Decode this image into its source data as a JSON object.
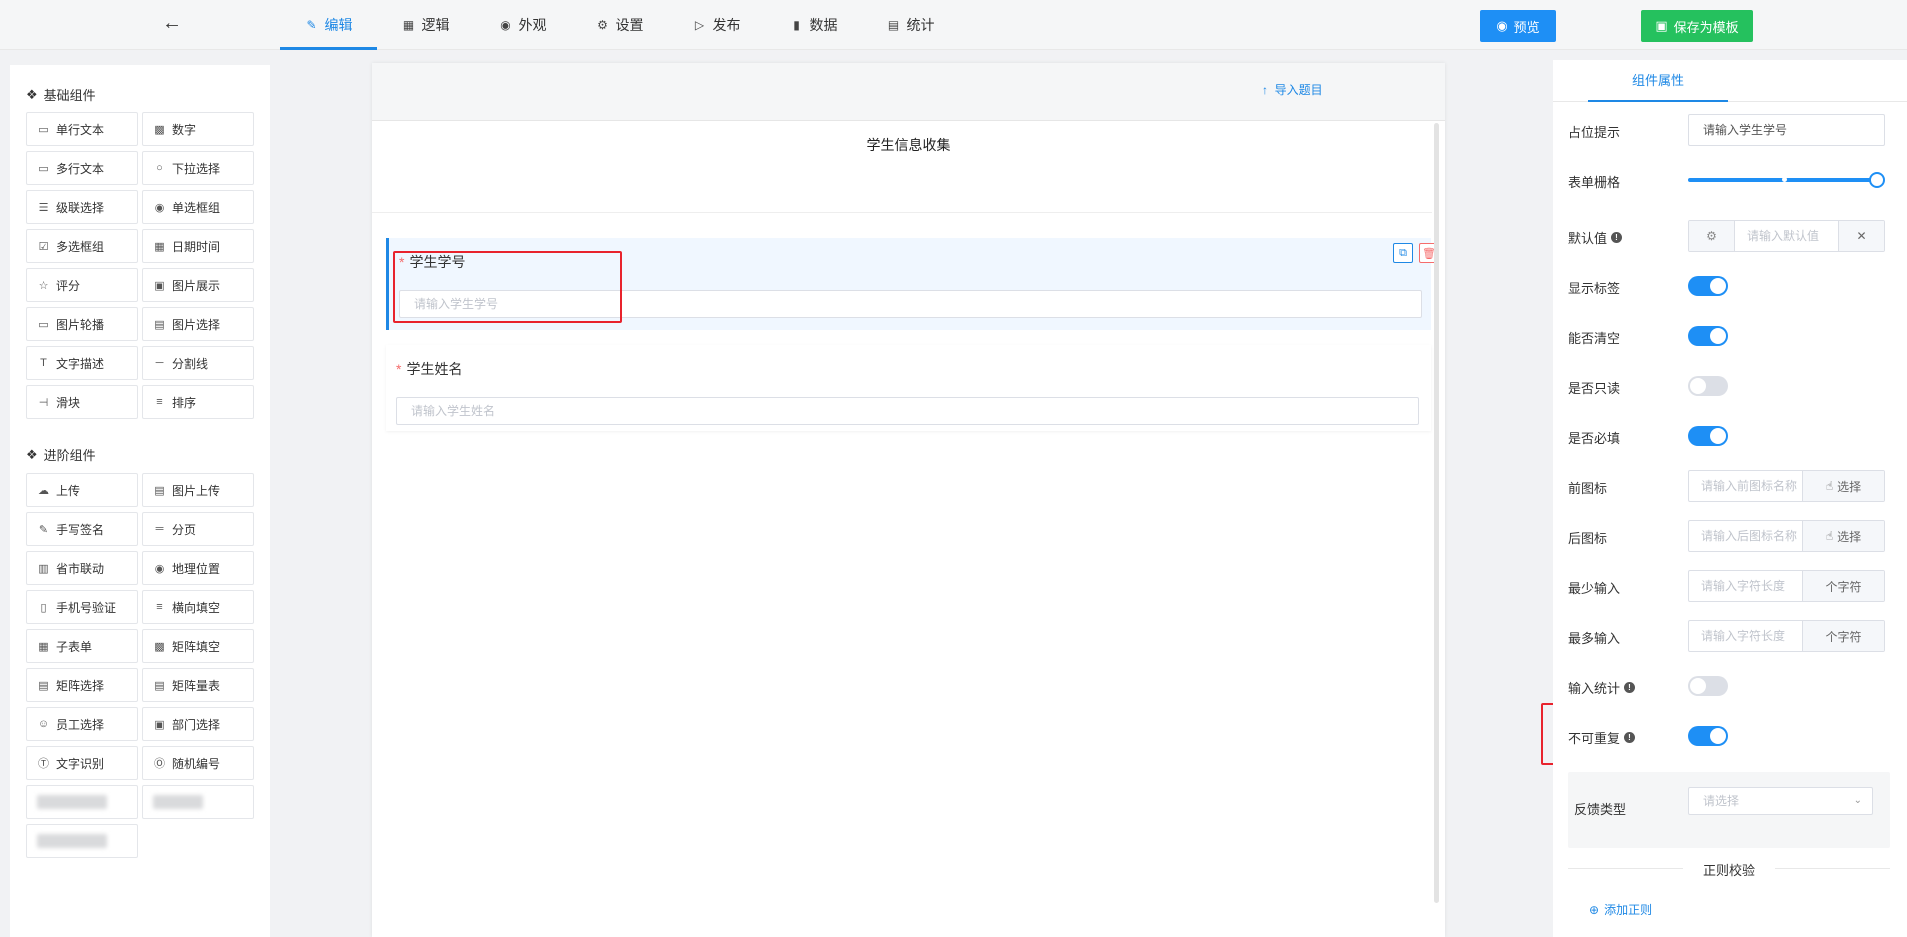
{
  "topbar": {
    "back_icon": "arrow-left-icon",
    "tabs": [
      {
        "label": "编辑",
        "icon": "pencil-icon"
      },
      {
        "label": "逻辑",
        "icon": "grid-icon"
      },
      {
        "label": "外观",
        "icon": "eye-icon"
      },
      {
        "label": "设置",
        "icon": "gear-icon"
      },
      {
        "label": "发布",
        "icon": "play-icon"
      },
      {
        "label": "数据",
        "icon": "bar-chart-icon"
      },
      {
        "label": "统计",
        "icon": "presentation-icon"
      }
    ],
    "active_tab": "编辑",
    "preview_label": "预览",
    "save_template_label": "保存为模板",
    "colors": {
      "accent": "#1e88e5",
      "preview_bg": "#1e8ff5",
      "save_bg": "#25c15e"
    }
  },
  "left": {
    "basic_title": "基础组件",
    "basic": [
      {
        "label": "单行文本",
        "icon": "input-icon"
      },
      {
        "label": "数字",
        "icon": "number-icon"
      },
      {
        "label": "多行文本",
        "icon": "textarea-icon"
      },
      {
        "label": "下拉选择",
        "icon": "dropdown-icon"
      },
      {
        "label": "级联选择",
        "icon": "cascader-icon"
      },
      {
        "label": "单选框组",
        "icon": "radio-icon"
      },
      {
        "label": "多选框组",
        "icon": "checkbox-icon"
      },
      {
        "label": "日期时间",
        "icon": "calendar-icon"
      },
      {
        "label": "评分",
        "icon": "star-icon"
      },
      {
        "label": "图片展示",
        "icon": "image-icon"
      },
      {
        "label": "图片轮播",
        "icon": "carousel-icon"
      },
      {
        "label": "图片选择",
        "icon": "image-select-icon"
      },
      {
        "label": "文字描述",
        "icon": "text-icon"
      },
      {
        "label": "分割线",
        "icon": "divider-icon"
      },
      {
        "label": "滑块",
        "icon": "slider-icon"
      },
      {
        "label": "排序",
        "icon": "sort-icon"
      }
    ],
    "advanced_title": "进阶组件",
    "advanced": [
      {
        "label": "上传",
        "icon": "upload-icon"
      },
      {
        "label": "图片上传",
        "icon": "image-upload-icon"
      },
      {
        "label": "手写签名",
        "icon": "signature-icon"
      },
      {
        "label": "分页",
        "icon": "pagination-icon"
      },
      {
        "label": "省市联动",
        "icon": "city-icon"
      },
      {
        "label": "地理位置",
        "icon": "location-icon"
      },
      {
        "label": "手机号验证",
        "icon": "phone-icon"
      },
      {
        "label": "横向填空",
        "icon": "fill-blank-icon"
      },
      {
        "label": "子表单",
        "icon": "subform-icon"
      },
      {
        "label": "矩阵填空",
        "icon": "matrix-fill-icon"
      },
      {
        "label": "矩阵选择",
        "icon": "matrix-select-icon"
      },
      {
        "label": "矩阵量表",
        "icon": "matrix-scale-icon"
      },
      {
        "label": "员工选择",
        "icon": "user-icon"
      },
      {
        "label": "部门选择",
        "icon": "department-icon"
      },
      {
        "label": "文字识别",
        "icon": "ocr-icon"
      },
      {
        "label": "随机编号",
        "icon": "number-no-icon"
      }
    ]
  },
  "canvas": {
    "import_label": "导入题目",
    "form_title": "学生信息收集",
    "fields": [
      {
        "label": "学生学号",
        "placeholder": "请输入学生学号",
        "required": true
      },
      {
        "label": "学生姓名",
        "placeholder": "请输入学生姓名",
        "required": true
      }
    ]
  },
  "right": {
    "tab_label": "组件属性",
    "placeholder_label": "占位提示",
    "placeholder_value": "请输入学生学号",
    "grid_label": "表单栅格",
    "grid_value_fraction": 1.0,
    "default_label": "默认值",
    "default_placeholder": "请输入默认值",
    "show_label_label": "显示标签",
    "show_label_on": true,
    "clearable_label": "能否清空",
    "clearable_on": true,
    "readonly_label": "是否只读",
    "readonly_on": false,
    "required_label": "是否必填",
    "required_on": true,
    "prefix_icon_label": "前图标",
    "prefix_icon_placeholder": "请输入前图标名称",
    "suffix_icon_label": "后图标",
    "suffix_icon_placeholder": "请输入后图标名称",
    "select_label": "选择",
    "min_label": "最少输入",
    "min_placeholder": "请输入字符长度",
    "max_label": "最多输入",
    "max_placeholder": "请输入字符长度",
    "char_unit": "个字符",
    "count_label": "输入统计",
    "count_on": false,
    "unique_label": "不可重复",
    "unique_on": true,
    "feedback_label": "反馈类型",
    "feedback_placeholder": "请选择",
    "regex_title": "正则校验",
    "add_rule_label": "添加正则"
  }
}
